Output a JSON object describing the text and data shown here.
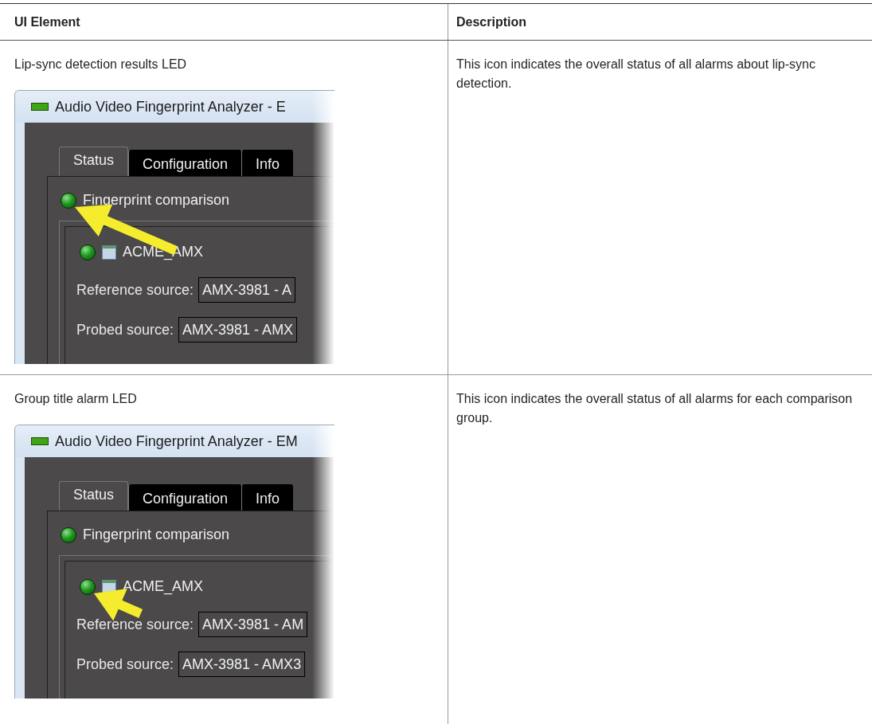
{
  "table": {
    "columns": [
      "UI Element",
      "Description"
    ],
    "rows": [
      {
        "element": "Lip-sync detection results LED",
        "description": "This icon indicates the overall status of all alarms about lip-sync detection.",
        "screenshot": {
          "title": "Audio Video Fingerprint Analyzer - E",
          "tabs": [
            {
              "label": "Status",
              "selected": true
            },
            {
              "label": "Configuration",
              "selected": false
            },
            {
              "label": "Info",
              "selected": false
            }
          ],
          "section": "Fingerprint comparison",
          "group": "ACME_AMX",
          "fields": [
            {
              "label": "Reference source:",
              "value": "AMX-3981 - A"
            },
            {
              "label": "Probed source:",
              "value": "AMX-3981 - AMX"
            }
          ],
          "section_led_marked": true,
          "group_led_marked": false
        }
      },
      {
        "element": "Group title alarm LED",
        "description": "This icon indicates the overall status of all alarms for each comparison group.",
        "screenshot": {
          "title": "Audio Video Fingerprint Analyzer - EM",
          "tabs": [
            {
              "label": "Status",
              "selected": true
            },
            {
              "label": "Configuration",
              "selected": false
            },
            {
              "label": "Info",
              "selected": false
            }
          ],
          "section": "Fingerprint comparison",
          "group": "ACME_AMX",
          "fields": [
            {
              "label": "Reference source:",
              "value": "AMX-3981 - AM"
            },
            {
              "label": "Probed source:",
              "value": "AMX-3981 - AMX3"
            }
          ],
          "section_led_marked": false,
          "group_led_marked": true
        }
      }
    ]
  }
}
